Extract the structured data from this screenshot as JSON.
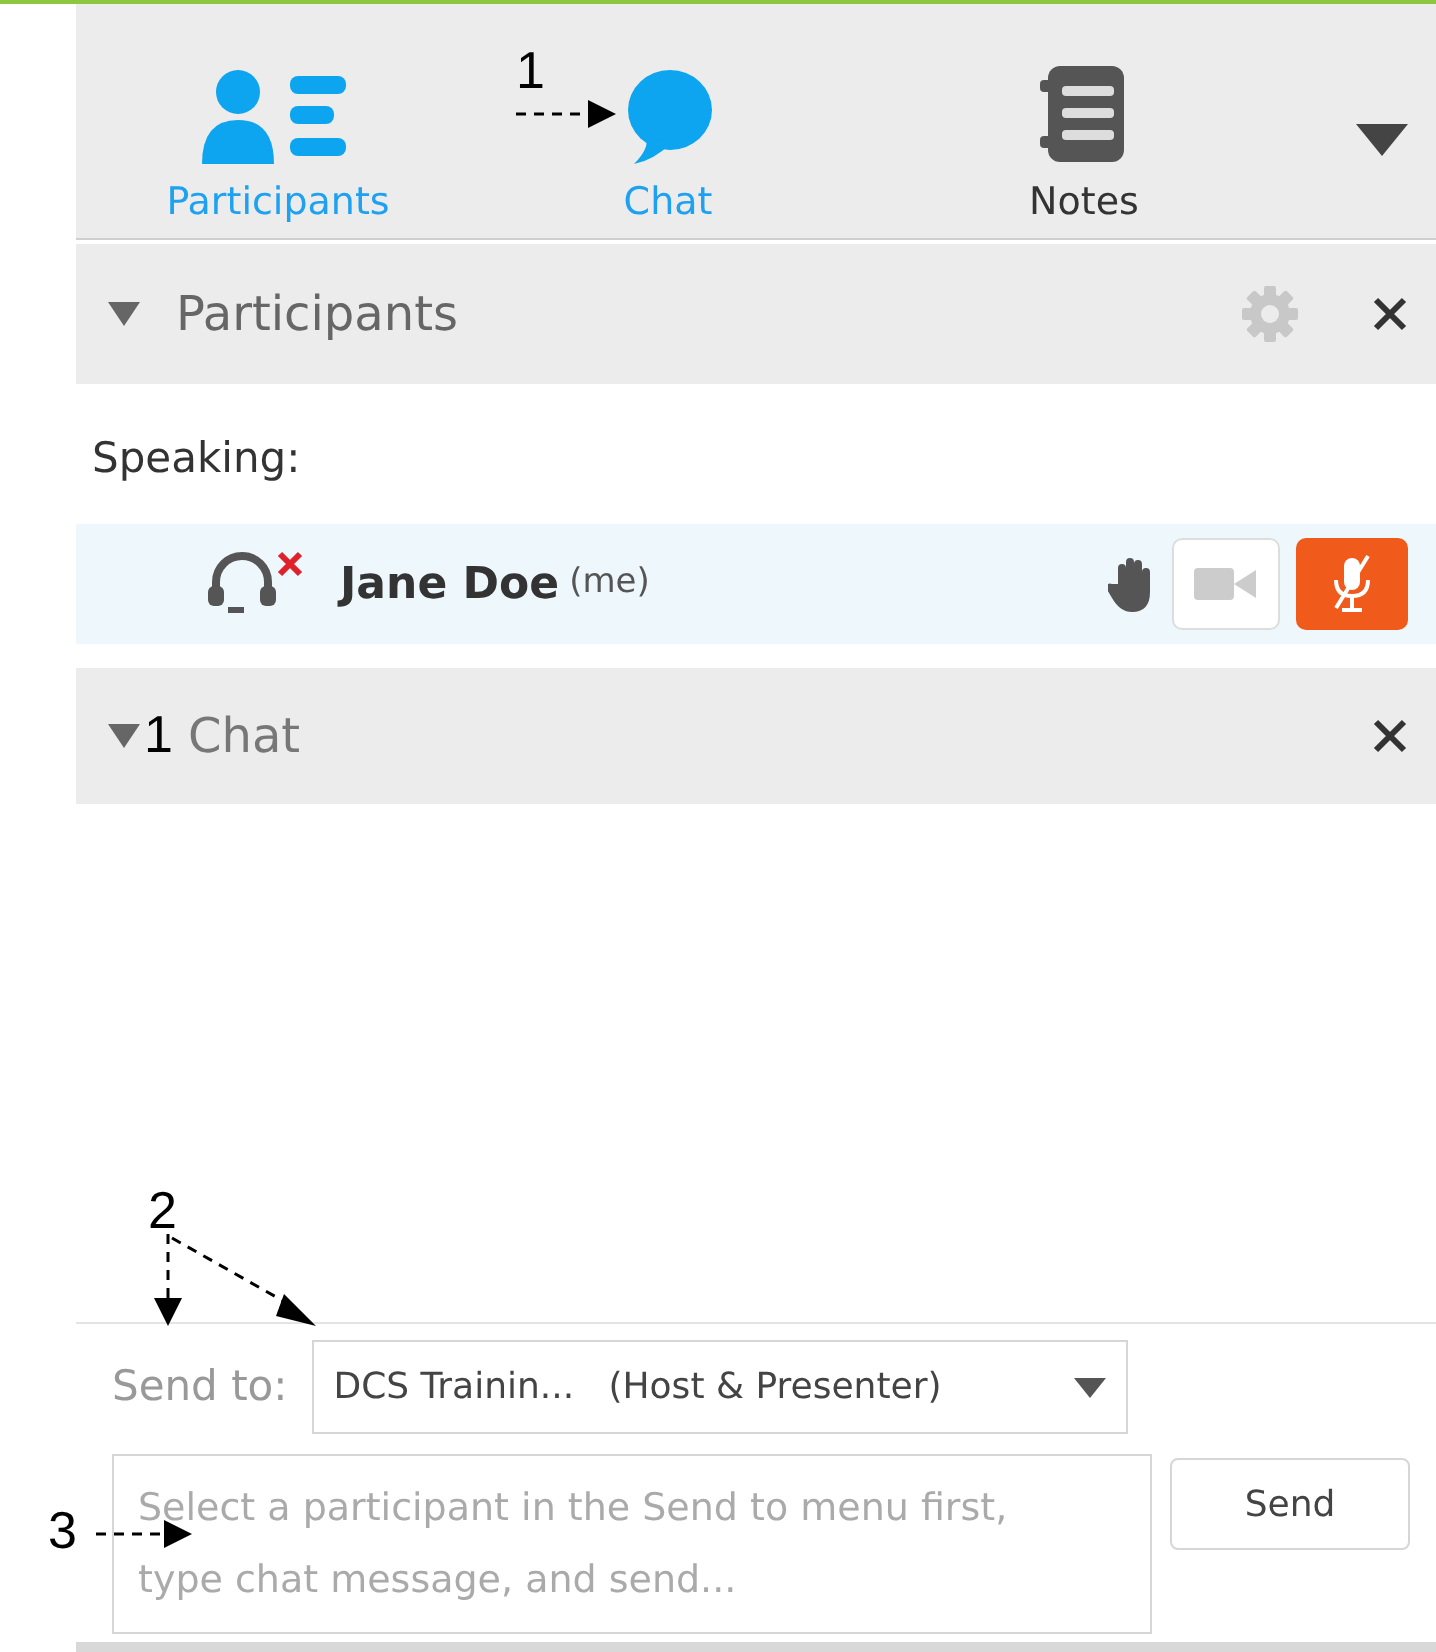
{
  "tabs": [
    {
      "kind": "participants",
      "label": "Participants",
      "active": true
    },
    {
      "kind": "chat",
      "label": "Chat",
      "active": true
    },
    {
      "kind": "notes",
      "label": "Notes",
      "active": false
    }
  ],
  "participants_panel": {
    "title": "Participants",
    "expanded": true,
    "speaking_label": "Speaking:",
    "participants": [
      {
        "name": "Jane Doe",
        "tag": "(me)",
        "audio_connected": false,
        "video_on": false,
        "mic_muted": true
      }
    ]
  },
  "chat_panel": {
    "title": "Chat",
    "expanded": true,
    "send_to_label": "Send to:",
    "recipient": "DCS Trainin...",
    "recipient_role": "(Host & Presenter)",
    "message_placeholder": "Select a participant in the Send to menu first, type chat message, and send...",
    "send_button": "Send"
  },
  "annotations": [
    {
      "label": "1"
    },
    {
      "label": "1"
    },
    {
      "label": "2"
    },
    {
      "label": "3"
    }
  ]
}
